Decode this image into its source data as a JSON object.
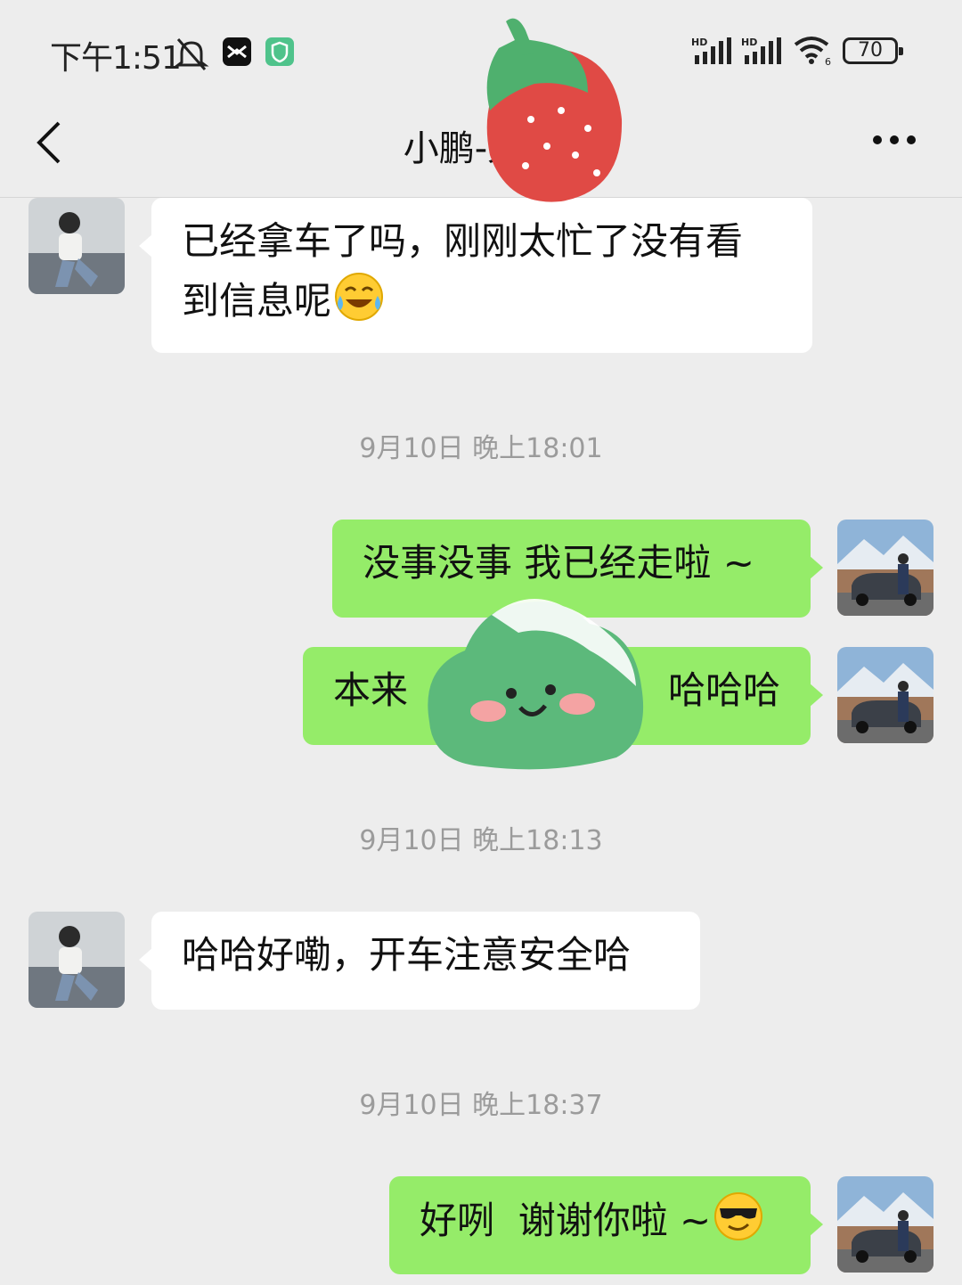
{
  "status_bar": {
    "time": "下午1:51",
    "battery": "70",
    "icons": [
      "mute-icon",
      "app-icon",
      "shield-app-icon",
      "hd-signal-icon",
      "hd-signal-icon",
      "wifi-icon",
      "battery-icon"
    ]
  },
  "nav": {
    "title": "小鹏-梁彩",
    "back_icon": "back-chevron-icon",
    "more_icon": "more-dots-icon"
  },
  "messages": [
    {
      "side": "in",
      "lines": [
        "已经拿车了吗，刚刚太忙了没有看",
        "到信息呢"
      ],
      "emoji": "laughing-tears-emoji"
    },
    {
      "type": "timestamp",
      "text": "9月10日 晚上18:01"
    },
    {
      "side": "out",
      "text": "没事没事 我已经走啦 ~"
    },
    {
      "side": "out",
      "text_left": "本来",
      "text_right": "哈哈哈"
    },
    {
      "type": "timestamp",
      "text": "9月10日 晚上18:13"
    },
    {
      "side": "in",
      "text": "哈哈好嘞，开车注意安全哈"
    },
    {
      "type": "timestamp",
      "text": "9月10日 晚上18:37"
    },
    {
      "side": "out",
      "text": "好咧  谢谢你啦 ~",
      "emoji": "sunglasses-emoji"
    }
  ],
  "colors": {
    "background": "#ededed",
    "incoming_bubble": "#ffffff",
    "outgoing_bubble": "#95ec69",
    "timestamp": "#9b9b9b"
  }
}
